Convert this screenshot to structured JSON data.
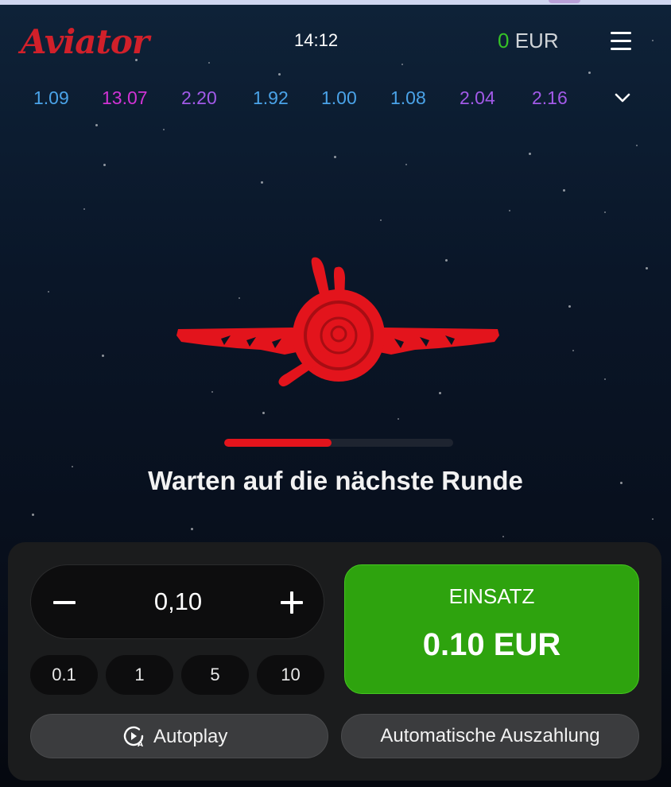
{
  "header": {
    "logo_text": "Aviator",
    "time": "14:12",
    "balance_amount": "0",
    "balance_currency": "EUR",
    "menu_icon": "hamburger-menu-icon"
  },
  "history": {
    "multipliers": [
      {
        "value": "1.09",
        "color": "#4aa3e8"
      },
      {
        "value": "13.07",
        "color": "#d033d4"
      },
      {
        "value": "2.20",
        "color": "#a25ae8"
      },
      {
        "value": "1.92",
        "color": "#4aa3e8"
      },
      {
        "value": "1.00",
        "color": "#4aa3e8"
      },
      {
        "value": "1.08",
        "color": "#4aa3e8"
      },
      {
        "value": "2.04",
        "color": "#a25ae8"
      },
      {
        "value": "2.16",
        "color": "#a25ae8"
      }
    ],
    "toggle_icon": "chevron-down-icon"
  },
  "game": {
    "status_text": "Warten auf die nächste Runde",
    "progress_fraction": 0.47,
    "plane_icon": "propeller-plane-icon",
    "plane_color": "#e3141c"
  },
  "bet_panel": {
    "amount_value": "0,10",
    "minus_icon": "minus-icon",
    "plus_icon": "plus-icon",
    "quick_amounts": [
      "0.1",
      "1",
      "5",
      "10"
    ],
    "bet_button_label": "EINSATZ",
    "bet_button_amount": "0.10 EUR",
    "bet_button_color": "#2ea30e",
    "autoplay_label": "Autoplay",
    "autoplay_icon": "autoplay-icon",
    "auto_cashout_label": "Automatische Auszahlung"
  }
}
